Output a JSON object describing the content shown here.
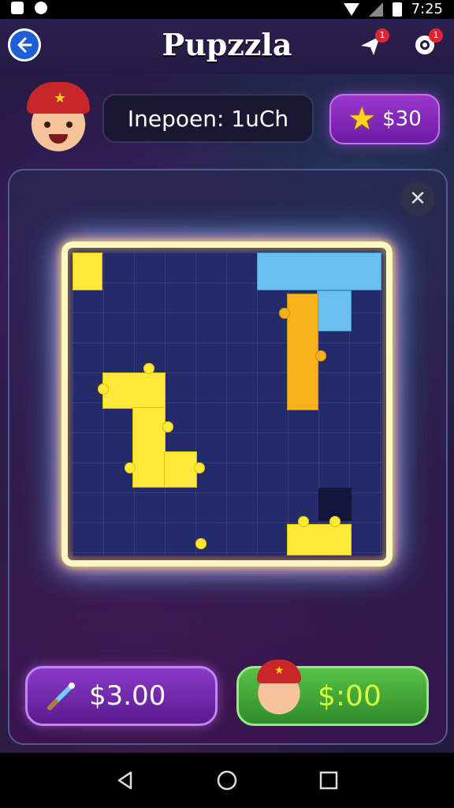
{
  "status_bar": {
    "time": "7:25"
  },
  "header": {
    "title": "Pupzzla",
    "notification_badge": "1",
    "settings_badge": "1"
  },
  "game": {
    "level_label": "Inepoen: 1uCh",
    "coins": "$30",
    "hint_button_label": "$3.00",
    "play_button_label": "$:00"
  },
  "icons": {
    "back": "back-arrow-icon",
    "notifications": "rocket-icon",
    "settings": "gear-icon",
    "coins": "star-icon",
    "close": "close-icon",
    "hint": "magic-wand-icon"
  },
  "colors": {
    "accent_purple": "#8a3ac9",
    "accent_green": "#3fa83a",
    "piece_yellow": "#ffe93a",
    "piece_orange": "#f7b21b",
    "piece_blue": "#6ac0f0",
    "board": "#232b6b"
  }
}
